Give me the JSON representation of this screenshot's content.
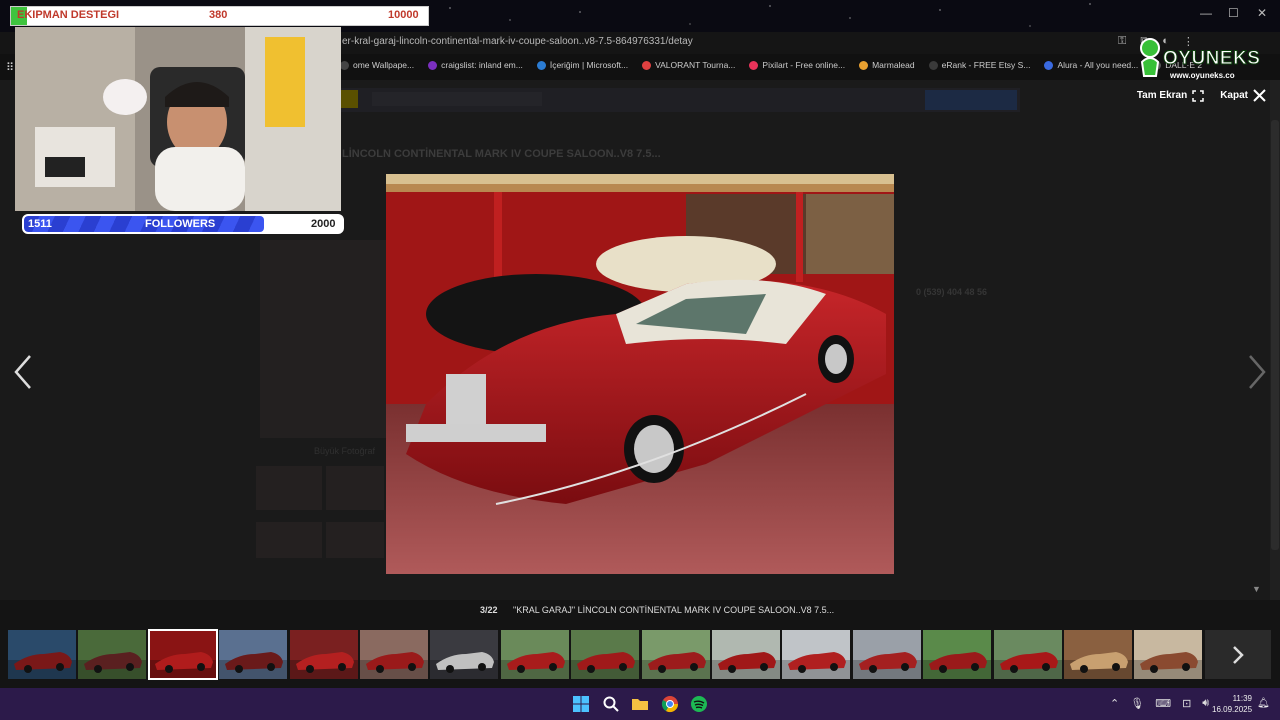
{
  "browser": {
    "url": "er-kral-garaj-lincoln-continental-mark-iv-coupe-saloon..v8-7.5-864976331/detay",
    "bookmarks": [
      {
        "label": "ome Wallpape...",
        "color": "#444444"
      },
      {
        "label": "craigslist: inland em...",
        "color": "#7b2fbf"
      },
      {
        "label": "İçeriğim | Microsoft...",
        "color": "#2b7cd3"
      },
      {
        "label": "VALORANT Tourna...",
        "color": "#e04040"
      },
      {
        "label": "Pixilart - Free online...",
        "color": "#e8335a"
      },
      {
        "label": "Marmalead",
        "color": "#e8a030"
      },
      {
        "label": "eRank - FREE Etsy S...",
        "color": "#3a3a3a"
      },
      {
        "label": "Alura - All you need...",
        "color": "#3a6ae0"
      },
      {
        "label": "DALL·E 2",
        "color": "#555555"
      }
    ]
  },
  "backdrop": {
    "title": "LİNCOLN CONTİNENTAL MARK IV COUPE SALOON..V8 7.5...",
    "phone": "0 (539) 404 48 56",
    "big_photo_label": "Büyük Fotoğraf"
  },
  "lightbox": {
    "fullscreen_label": "Tam Ekran",
    "close_label": "Kapat",
    "counter": "3/22",
    "caption": "\"KRAL GARAJ\" LİNCOLN CONTİNENTAL MARK IV COUPE SALOON..V8 7.5...",
    "thumbnails": [
      {
        "bg": "#2a4a6a",
        "car": "#7a1818"
      },
      {
        "bg": "#4a6a3a",
        "car": "#5a2020"
      },
      {
        "bg": "#8a1414",
        "car": "#b01c1c"
      },
      {
        "bg": "#5a7090",
        "car": "#6a1a1a"
      },
      {
        "bg": "#7a2020",
        "car": "#b42020"
      },
      {
        "bg": "#8a6a60",
        "car": "#9a1a1a"
      },
      {
        "bg": "#3a3a40",
        "car": "#c0c0c0"
      },
      {
        "bg": "#6a8a5a",
        "car": "#a81c1c"
      },
      {
        "bg": "#5a7a4a",
        "car": "#a01a1a"
      },
      {
        "bg": "#7a9a6a",
        "car": "#9c1c1c"
      },
      {
        "bg": "#b0b8b0",
        "car": "#a01818"
      },
      {
        "bg": "#c0c4c8",
        "car": "#b02020"
      },
      {
        "bg": "#9aa0a8",
        "car": "#a42020"
      },
      {
        "bg": "#5a8a4a",
        "car": "#9a1a1a"
      },
      {
        "bg": "#6a8a60",
        "car": "#a81818"
      },
      {
        "bg": "#8a6040",
        "car": "#c8a070"
      },
      {
        "bg": "#c8b8a0",
        "car": "#8a4a30"
      }
    ],
    "active_index": 2
  },
  "stream": {
    "donation_label": "EKIPMAN DESTEGI",
    "donation_current": "380",
    "donation_goal": "10000",
    "donation_progress": 0.038,
    "followers_current": "1511",
    "followers_label": "FOLLOWERS",
    "followers_goal": "2000",
    "followers_progress": 0.7555,
    "brand_name": "OYUNEKS",
    "brand_url": "www.oyuneks.co"
  },
  "taskbar": {
    "time": "11:39",
    "date": "16.09.2025"
  },
  "colors": {
    "accent_red": "#c0392b",
    "followers_blue": "#2a3fd1",
    "taskbar": "#2c1a4a"
  }
}
